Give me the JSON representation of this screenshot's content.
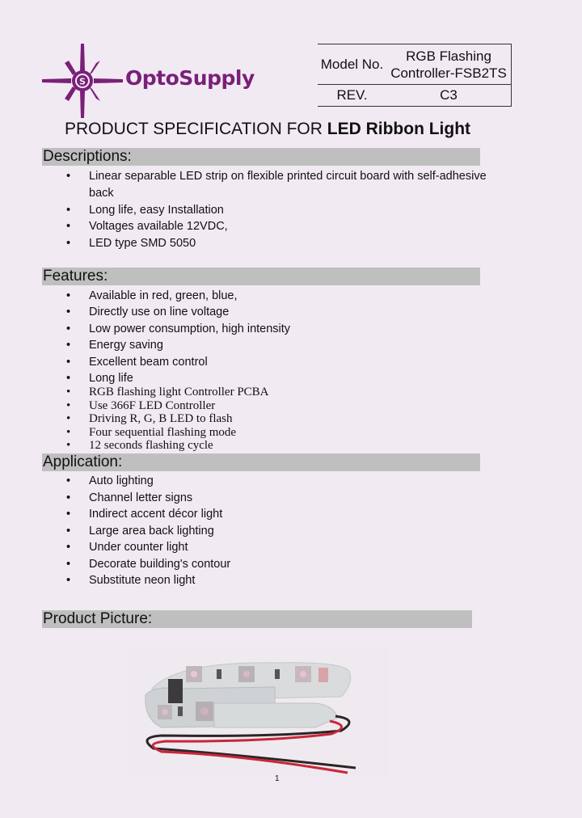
{
  "header": {
    "brand": "OptoSupply",
    "logo_icon": "compass-star-s-logo",
    "table": {
      "model_label": "Model No.",
      "model_value_line1": "RGB Flashing",
      "model_value_line2": "Controller-FSB2TS",
      "rev_label": "REV.",
      "rev_value": "C3"
    }
  },
  "title": {
    "prefix": "PRODUCT SPECIFICATION FOR ",
    "product": "LED Ribbon Light"
  },
  "sections": {
    "descriptions": {
      "heading": "Descriptions:",
      "items": [
        "Linear separable LED strip on flexible printed circuit board with self-adhesive",
        "back",
        "Long life, easy Installation",
        "Voltages available 12VDC,",
        "LED type SMD 5050"
      ]
    },
    "features": {
      "heading": "Features:",
      "items": [
        "Available in red, green, blue,",
        "Directly use on line voltage",
        "Low power consumption, high intensity",
        "Energy saving",
        "Excellent beam control",
        "Long life",
        "RGB flashing light Controller PCBA",
        "Use 366F LED Controller",
        "Driving R, G, B LED to flash",
        "Four sequential flashing mode",
        "12 seconds flashing cycle"
      ]
    },
    "application": {
      "heading": "Application:",
      "items": [
        "Auto lighting",
        "Channel letter signs",
        "Indirect accent décor light",
        "Large area back lighting",
        "Under counter light",
        "Decorate building's contour",
        "Substitute neon light"
      ]
    },
    "picture": {
      "heading": "Product Picture:",
      "image_alt": "LED ribbon strip with controller and red/black wires"
    }
  },
  "bullet": "•",
  "page_number": "1",
  "colors": {
    "brand": "#7a1f7a",
    "section_bg": "#bfbfbf",
    "page_bg": "#f1eaf2"
  }
}
